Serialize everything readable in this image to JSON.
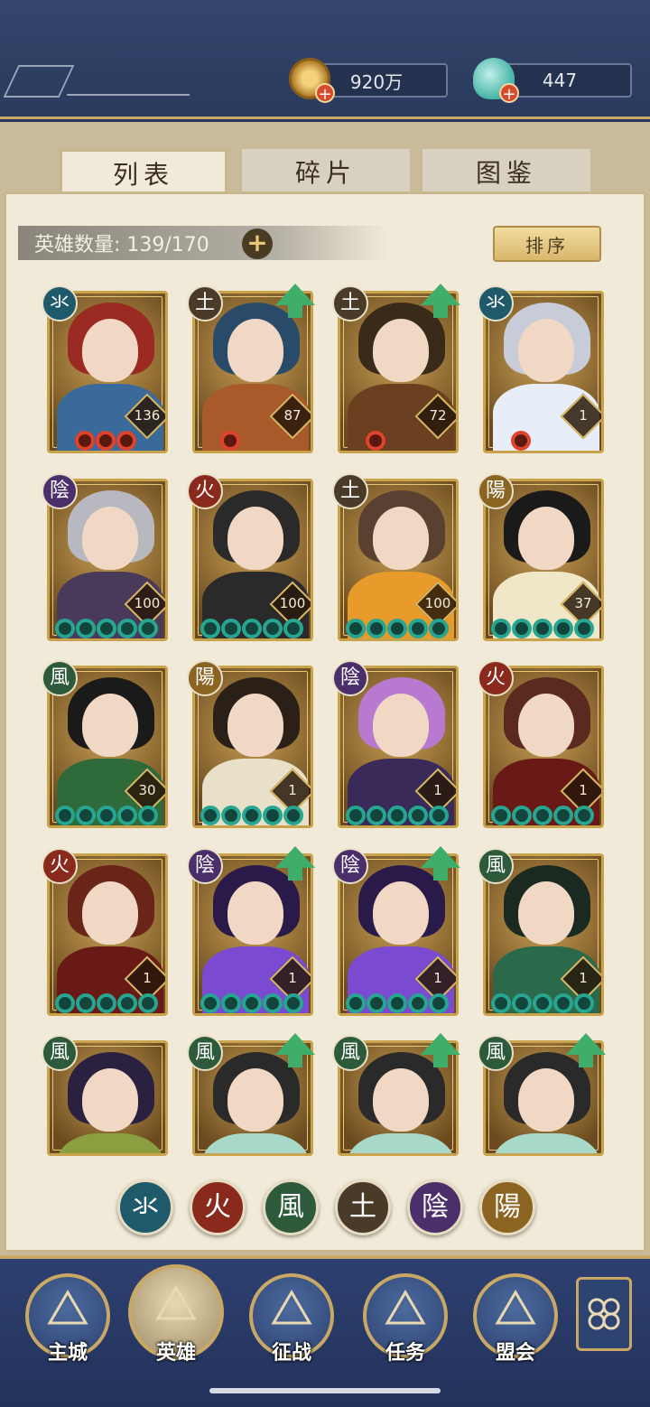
{
  "currency": {
    "coins": "920万",
    "jade": "447"
  },
  "tabs": [
    "列表",
    "碎片",
    "图鉴"
  ],
  "hero_count_label": "英雄数量: 139/170",
  "sort_label": "排序",
  "element_glyphs": {
    "water": "氺",
    "fire": "火",
    "wind": "風",
    "earth": "土",
    "yin": "陰",
    "yang": "陽"
  },
  "element_colors": {
    "water": "#1f5a6a",
    "fire": "#8a2a1c",
    "wind": "#2d5a3a",
    "earth": "#4a3b28",
    "yin": "#4a2f6a",
    "yang": "#8a6420"
  },
  "heroes": [
    {
      "element": "氺",
      "element_key": "water",
      "level": "136",
      "stars": 3,
      "star_color": "red",
      "upgrade": false
    },
    {
      "element": "土",
      "element_key": "earth",
      "level": "87",
      "stars": 1,
      "star_color": "red",
      "upgrade": true
    },
    {
      "element": "土",
      "element_key": "earth",
      "level": "72",
      "stars": 1,
      "star_color": "red",
      "upgrade": true
    },
    {
      "element": "氺",
      "element_key": "water",
      "level": "1",
      "stars": 1,
      "star_color": "red",
      "upgrade": false
    },
    {
      "element": "陰",
      "element_key": "yin",
      "level": "100",
      "stars": 5,
      "star_color": "green",
      "upgrade": false
    },
    {
      "element": "火",
      "element_key": "fire",
      "level": "100",
      "stars": 5,
      "star_color": "green",
      "upgrade": false
    },
    {
      "element": "土",
      "element_key": "earth",
      "level": "100",
      "stars": 5,
      "star_color": "green",
      "upgrade": false
    },
    {
      "element": "陽",
      "element_key": "yang",
      "level": "37",
      "stars": 5,
      "star_color": "green",
      "upgrade": false
    },
    {
      "element": "風",
      "element_key": "wind",
      "level": "30",
      "stars": 5,
      "star_color": "green",
      "upgrade": false
    },
    {
      "element": "陽",
      "element_key": "yang",
      "level": "1",
      "stars": 5,
      "star_color": "green",
      "upgrade": false
    },
    {
      "element": "陰",
      "element_key": "yin",
      "level": "1",
      "stars": 5,
      "star_color": "green",
      "upgrade": false
    },
    {
      "element": "火",
      "element_key": "fire",
      "level": "1",
      "stars": 5,
      "star_color": "green",
      "upgrade": false
    },
    {
      "element": "火",
      "element_key": "fire",
      "level": "1",
      "stars": 5,
      "star_color": "green",
      "upgrade": false
    },
    {
      "element": "陰",
      "element_key": "yin",
      "level": "1",
      "stars": 5,
      "star_color": "green",
      "upgrade": true
    },
    {
      "element": "陰",
      "element_key": "yin",
      "level": "1",
      "stars": 5,
      "star_color": "green",
      "upgrade": true
    },
    {
      "element": "風",
      "element_key": "wind",
      "level": "1",
      "stars": 5,
      "star_color": "green",
      "upgrade": false
    },
    {
      "element": "風",
      "element_key": "wind",
      "level": "",
      "stars": 0,
      "star_color": "green",
      "upgrade": false
    },
    {
      "element": "風",
      "element_key": "wind",
      "level": "",
      "stars": 0,
      "star_color": "green",
      "upgrade": true
    },
    {
      "element": "風",
      "element_key": "wind",
      "level": "",
      "stars": 0,
      "star_color": "green",
      "upgrade": true
    },
    {
      "element": "風",
      "element_key": "wind",
      "level": "",
      "stars": 0,
      "star_color": "green",
      "upgrade": true
    }
  ],
  "filters": [
    {
      "glyph": "氺",
      "key": "water"
    },
    {
      "glyph": "火",
      "key": "fire"
    },
    {
      "glyph": "風",
      "key": "wind"
    },
    {
      "glyph": "土",
      "key": "earth"
    },
    {
      "glyph": "陰",
      "key": "yin"
    },
    {
      "glyph": "陽",
      "key": "yang"
    }
  ],
  "nav": {
    "items": [
      "主城",
      "英雄",
      "征战",
      "任务",
      "盟会"
    ],
    "active_index": 1
  }
}
